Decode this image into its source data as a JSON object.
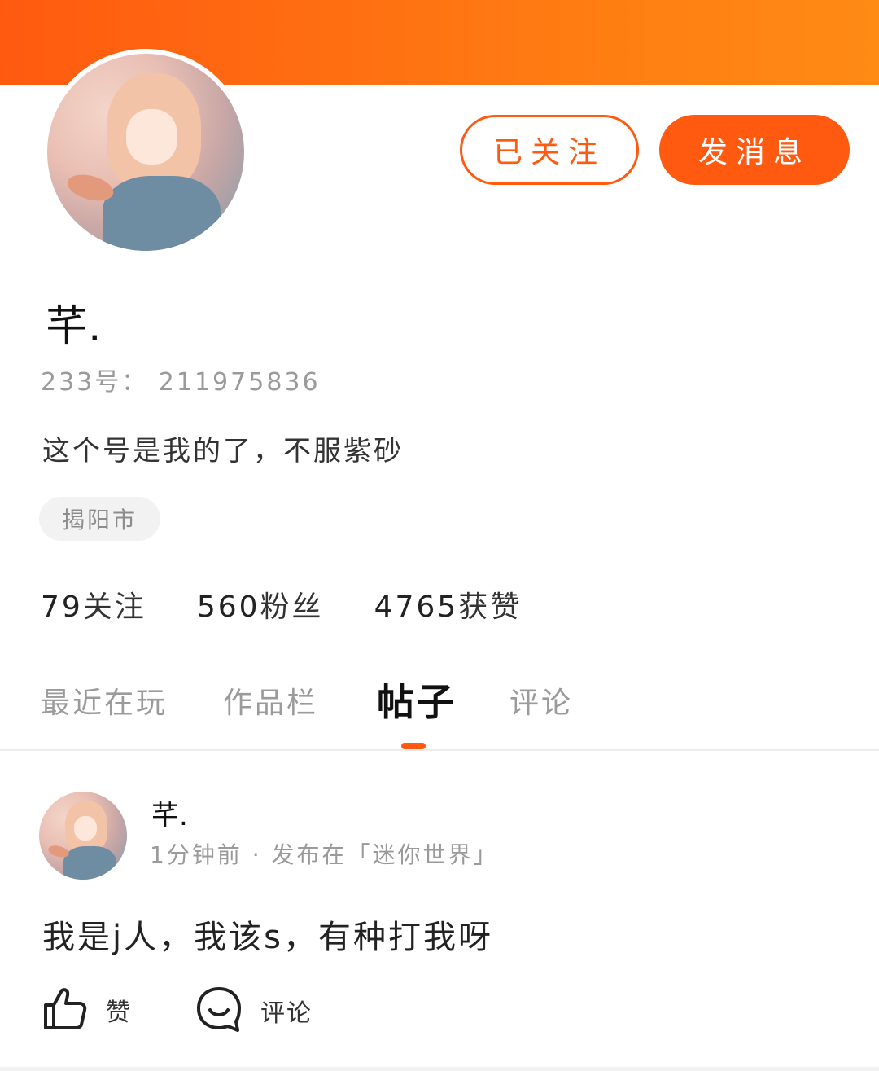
{
  "profile": {
    "nickname": "芊.",
    "uid_text": "233号： 211975836",
    "bio": "这个号是我的了，不服紫砂",
    "location": "揭阳市",
    "follow_button": "已关注",
    "message_button": "发消息"
  },
  "stats": [
    {
      "count": "79",
      "label": "关注"
    },
    {
      "count": "560",
      "label": "粉丝"
    },
    {
      "count": "4765",
      "label": "获赞"
    }
  ],
  "tabs": [
    {
      "label": "最近在玩"
    },
    {
      "label": "作品栏"
    },
    {
      "label": "帖子",
      "active": true
    },
    {
      "label": "评论"
    }
  ],
  "post": {
    "author": "芊.",
    "meta": "1分钟前 · 发布在「迷你世界」",
    "text": "我是j人，我该s，有种打我呀",
    "like_label": "赞",
    "comment_label": "评论"
  },
  "colors": {
    "accent": "#ff5a10",
    "banner_start": "#ff5a10",
    "banner_end": "#ff8a14"
  },
  "icons": [
    "thumbs-up-icon",
    "comment-bubble-icon"
  ]
}
